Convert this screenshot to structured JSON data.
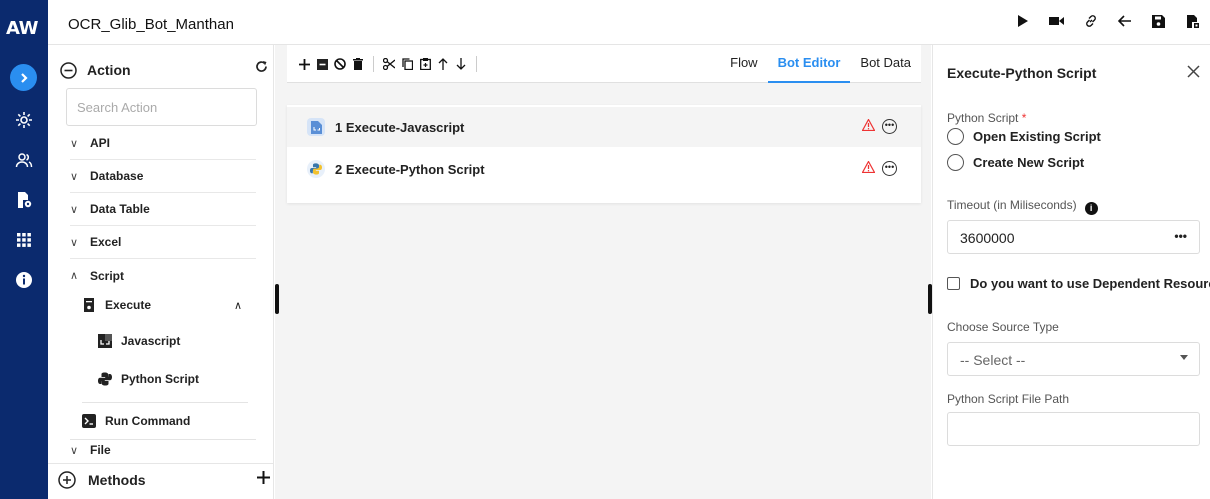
{
  "app": {
    "logo": "AW",
    "title": "OCR_Glib_Bot_Manthan"
  },
  "rail": {
    "items": [
      "chevron-right-icon",
      "settings-icon",
      "users-icon",
      "document-gear-icon",
      "grid-icon",
      "info-icon"
    ]
  },
  "topbar": {
    "icons": [
      "play-icon",
      "video-icon",
      "link-icon",
      "back-arrow-icon",
      "save-icon",
      "export-icon"
    ]
  },
  "action_panel": {
    "title": "Action",
    "search_placeholder": "Search Action",
    "categories": [
      {
        "label": "API",
        "expanded": false
      },
      {
        "label": "Database",
        "expanded": false
      },
      {
        "label": "Data Table",
        "expanded": false
      },
      {
        "label": "Excel",
        "expanded": false
      },
      {
        "label": "Script",
        "expanded": true
      }
    ],
    "execute_label": "Execute",
    "javascript_label": "Javascript",
    "python_label": "Python Script",
    "run_command_label": "Run Command",
    "file_label": "File",
    "methods_label": "Methods"
  },
  "editor": {
    "tabs": [
      "Flow",
      "Bot Editor",
      "Bot Data"
    ],
    "active_tab": "Bot Editor",
    "steps": [
      {
        "label": "1 Execute-Javascript"
      },
      {
        "label": "2 Execute-Python Script"
      }
    ]
  },
  "props": {
    "title": "Execute-Python Script",
    "python_script_label": "Python Script",
    "required_mark": "*",
    "option_existing": "Open Existing Script",
    "option_new": "Create New Script",
    "timeout_label": "Timeout (in Miliseconds)",
    "timeout_value": "3600000",
    "dependent_label": "Do you want to use Dependent Resources",
    "source_type_label": "Choose Source Type",
    "select_value": "-- Select --",
    "file_path_label": "Python Script File Path"
  },
  "colors": {
    "rail_bg": "#0b2a6e",
    "accent": "#2a8ef0",
    "warning": "#e33333"
  }
}
